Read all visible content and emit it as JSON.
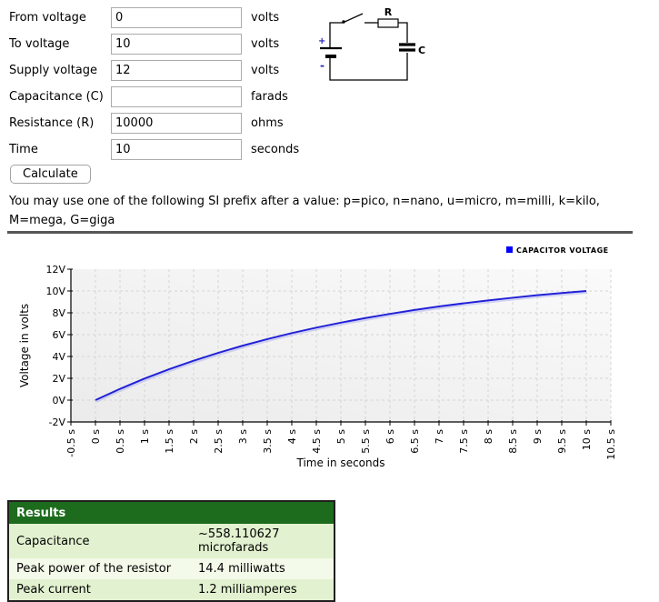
{
  "form": {
    "rows": [
      {
        "label": "From voltage",
        "value": "0",
        "unit": "volts"
      },
      {
        "label": "To voltage",
        "value": "10",
        "unit": "volts"
      },
      {
        "label": "Supply voltage",
        "value": "12",
        "unit": "volts"
      },
      {
        "label": "Capacitance (C)",
        "value": "",
        "unit": "farads"
      },
      {
        "label": "Resistance (R)",
        "value": "10000",
        "unit": "ohms"
      },
      {
        "label": "Time",
        "value": "10",
        "unit": "seconds"
      }
    ],
    "calculate_label": "Calculate"
  },
  "circuit": {
    "resistor_label": "R",
    "capacitor_label": "C",
    "plus_label": "+",
    "minus_label": "-"
  },
  "note_text": "You may use one of the following SI prefix after a value: p=pico, n=nano, u=micro, m=milli, k=kilo, M=mega, G=giga",
  "chart_data": {
    "type": "line",
    "legend": [
      "CAPACITOR VOLTAGE"
    ],
    "xlabel": "Time in seconds",
    "ylabel": "Voltage in volts",
    "xlim": [
      -0.5,
      10.5
    ],
    "ylim": [
      -2,
      12
    ],
    "x_tick_step": 0.5,
    "y_tick_step": 2,
    "x_tick_suffix": " s",
    "y_tick_suffix": "V",
    "grid": true,
    "legend_position": "top-right",
    "series": [
      {
        "name": "CAPACITOR VOLTAGE",
        "color": "#2121d8",
        "x": [
          0,
          0.5,
          1,
          1.5,
          2,
          2.5,
          3,
          3.5,
          4,
          4.5,
          5,
          5.5,
          6,
          6.5,
          7,
          7.5,
          8,
          8.5,
          9,
          9.5,
          10
        ],
        "y": [
          0,
          1.03,
          1.97,
          2.83,
          3.61,
          4.33,
          4.99,
          5.59,
          6.14,
          6.64,
          7.1,
          7.52,
          7.9,
          8.26,
          8.58,
          8.87,
          9.14,
          9.38,
          9.61,
          9.81,
          10.0
        ]
      }
    ]
  },
  "results": {
    "header": "Results",
    "rows": [
      {
        "label": "Capacitance",
        "value": "~558.110627 microfarads"
      },
      {
        "label": "Peak power of the resistor",
        "value": "14.4 milliwatts"
      },
      {
        "label": "Peak current",
        "value": "1.2 milliamperes"
      }
    ]
  },
  "colors": {
    "legend_swatch": "#0000ff",
    "curve": "#2121d8",
    "results_header_bg": "#1d6b1d",
    "results_row_green": "#e2f1cf",
    "results_row_light": "#f3fae9"
  }
}
